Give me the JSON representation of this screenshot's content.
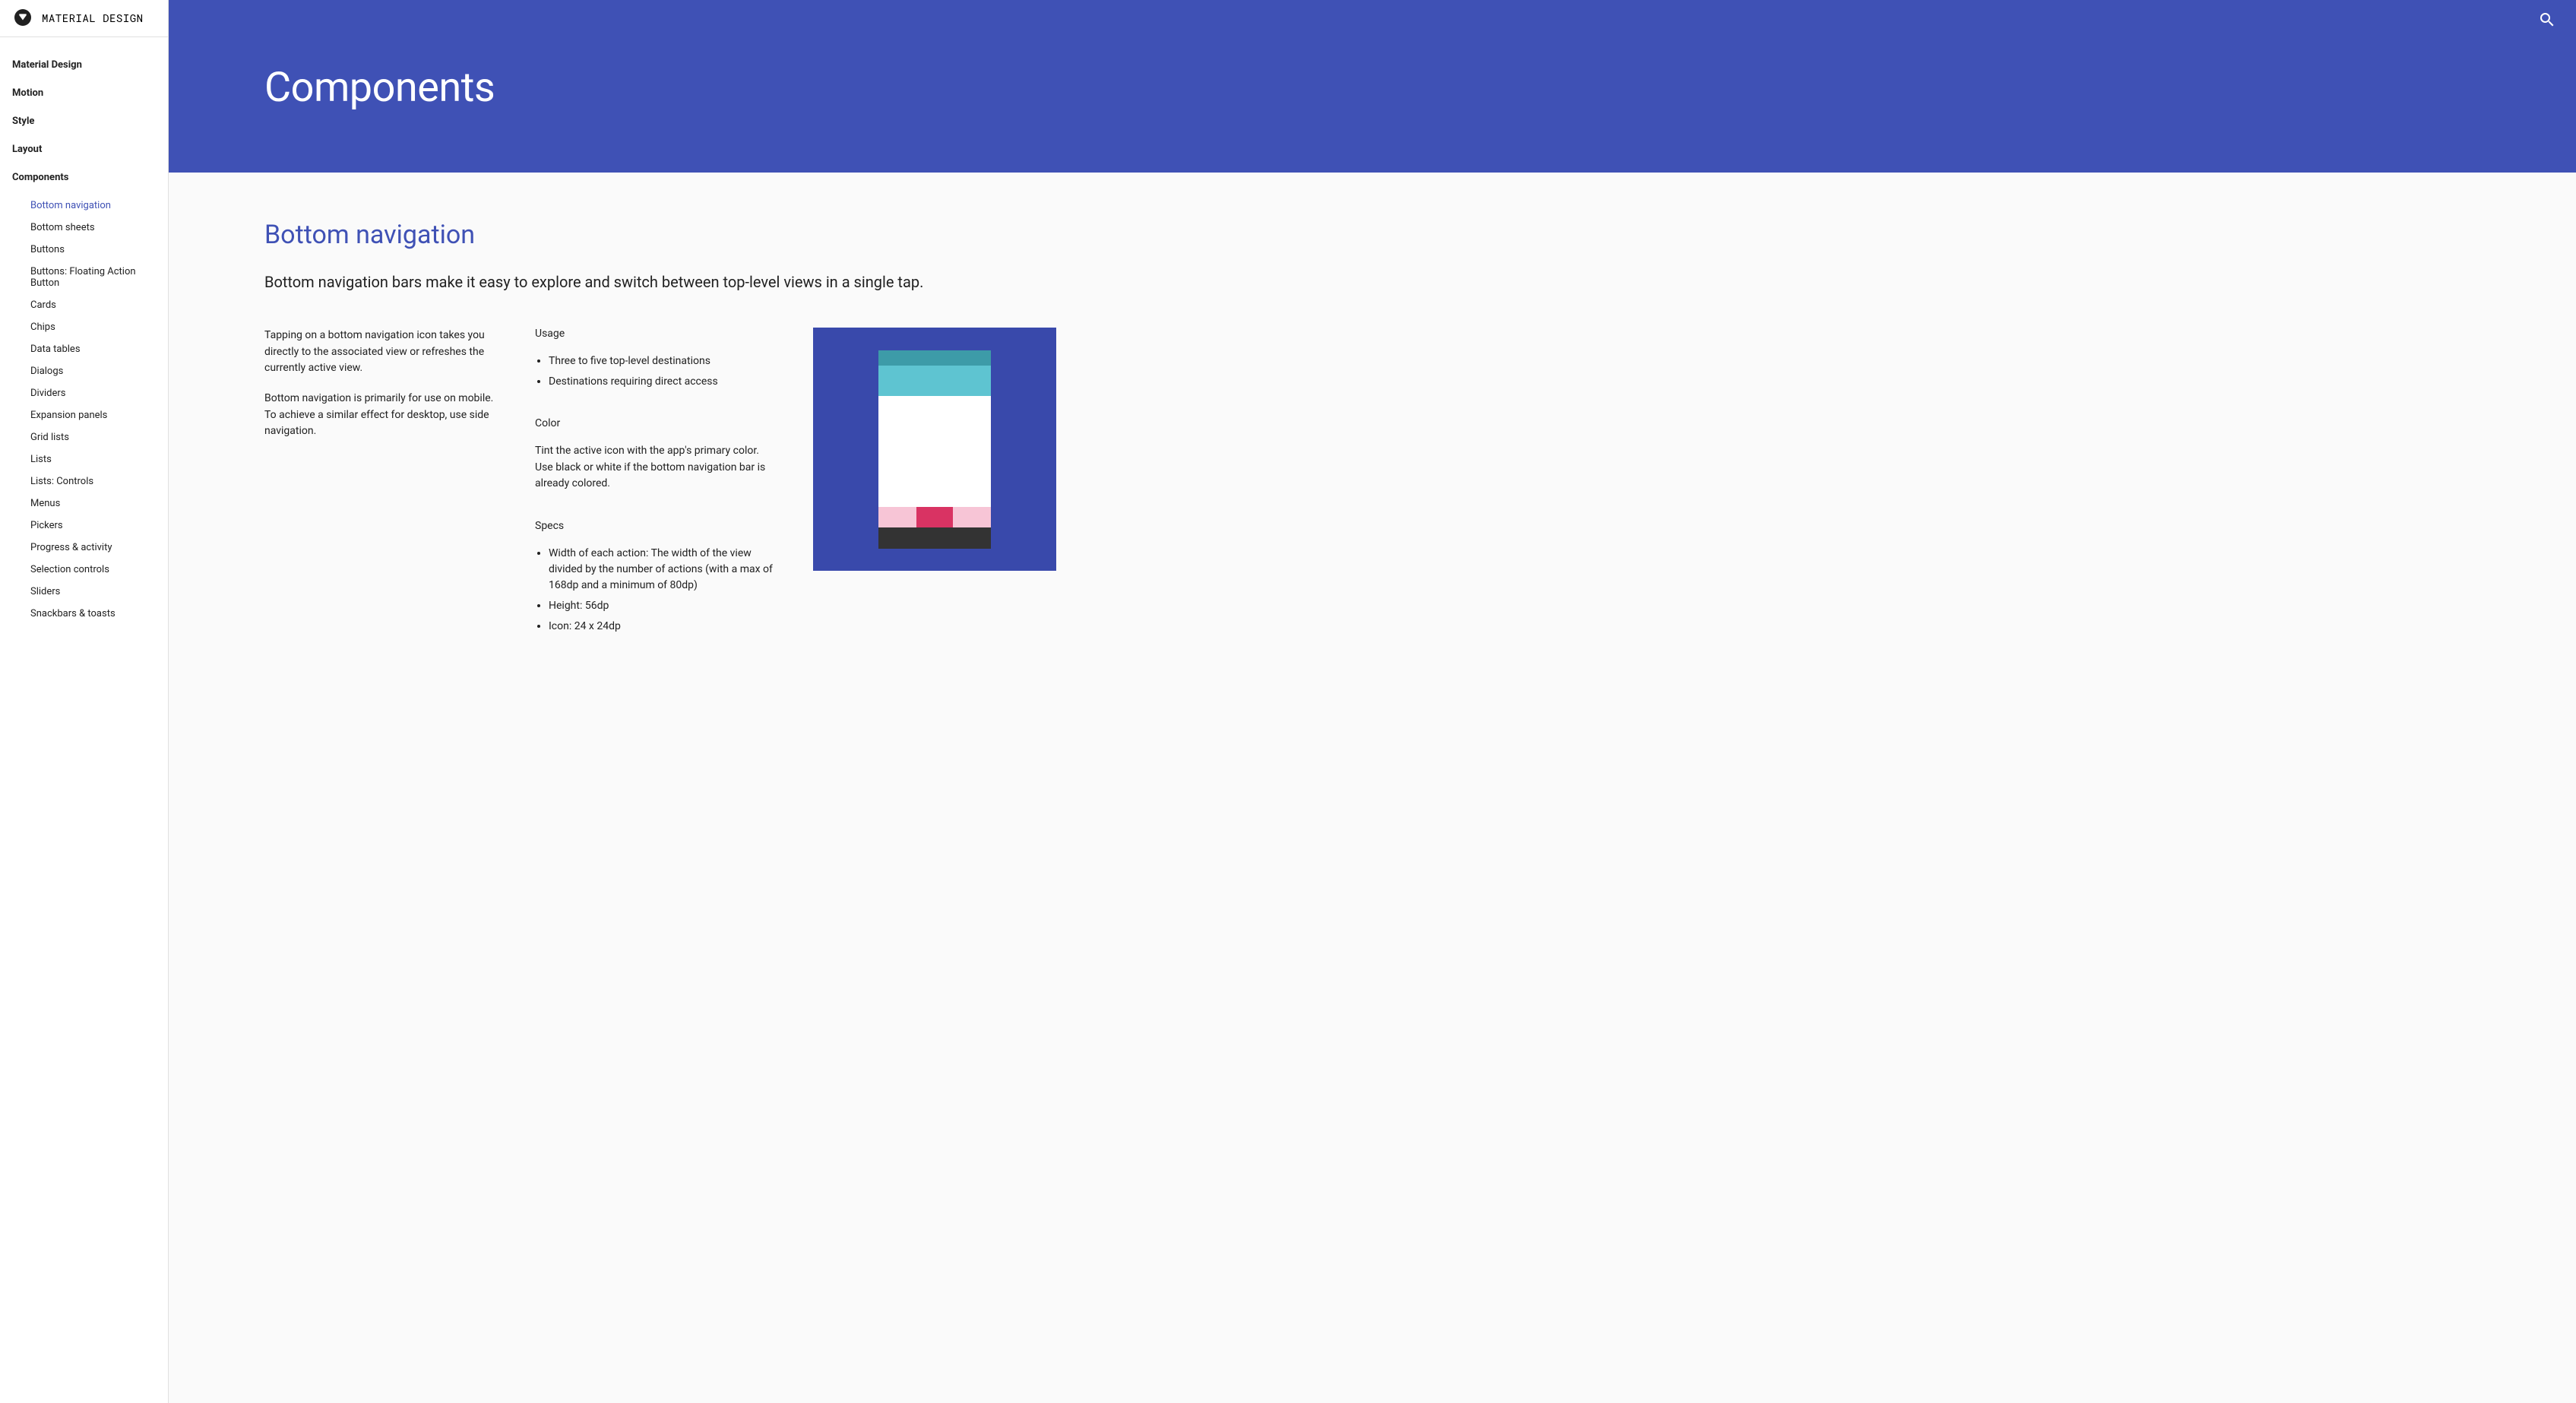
{
  "brand": {
    "name": "MATERIAL DESIGN"
  },
  "nav": {
    "items": [
      {
        "label": "Material Design"
      },
      {
        "label": "Motion"
      },
      {
        "label": "Style"
      },
      {
        "label": "Layout"
      },
      {
        "label": "Components"
      }
    ]
  },
  "subnav": {
    "items": [
      {
        "label": "Bottom navigation",
        "active": true
      },
      {
        "label": "Bottom sheets"
      },
      {
        "label": "Buttons"
      },
      {
        "label": "Buttons: Floating Action Button"
      },
      {
        "label": "Cards"
      },
      {
        "label": "Chips"
      },
      {
        "label": "Data tables"
      },
      {
        "label": "Dialogs"
      },
      {
        "label": "Dividers"
      },
      {
        "label": "Expansion panels"
      },
      {
        "label": "Grid lists"
      },
      {
        "label": "Lists"
      },
      {
        "label": "Lists: Controls"
      },
      {
        "label": "Menus"
      },
      {
        "label": "Pickers"
      },
      {
        "label": "Progress & activity"
      },
      {
        "label": "Selection controls"
      },
      {
        "label": "Sliders"
      },
      {
        "label": "Snackbars & toasts"
      }
    ]
  },
  "hero": {
    "title": "Components"
  },
  "page": {
    "title": "Bottom navigation",
    "intro": "Bottom navigation bars make it easy to explore and switch between top-level views in a single tap.",
    "left": {
      "p1": "Tapping on a bottom navigation icon takes you directly to the associated view or refreshes the currently active view.",
      "p2": "Bottom navigation is primarily for use on mobile. To achieve a similar effect for desktop, use side navigation."
    },
    "usage": {
      "heading": "Usage",
      "items": [
        "Three to five top-level destinations",
        "Destinations requiring direct access"
      ]
    },
    "color": {
      "heading": "Color",
      "text": "Tint the active icon with the app's primary color. Use black or white if the bottom navigation bar is already colored."
    },
    "specs": {
      "heading": "Specs",
      "items": [
        "Width of each action: The width of the view divided by the number of actions (with a max of 168dp and a minimum of 80dp)",
        "Height: 56dp",
        "Icon: 24 x 24dp"
      ]
    }
  }
}
